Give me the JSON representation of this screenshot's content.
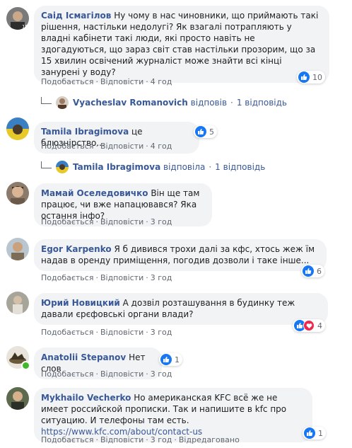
{
  "separator": "·",
  "comments": [
    {
      "author": "Саід Ісмагілов",
      "text": "Ну чому в нас чиновники, що приймають такі рішення, настільки недолугі? Як взагалі потрапляють у владні кабінети такі люди, які просто навіть не здогадуються, що зараз світ став настільки прозорим, що за 15 хвилин освічений журналіст може знайти всі кінці занурені у воду?",
      "like_label": "Подобається",
      "reply_label": "Відповісти",
      "time": "4 год",
      "reactions": 10,
      "reaction_types": [
        "like"
      ],
      "reply_summary": {
        "name": "Vyacheslav Romanovich",
        "verb": "відповів",
        "count_text": "1 відповідь"
      }
    },
    {
      "author": "Tamila Ibragimova",
      "text": "це блюзнірство...",
      "like_label": "Подобається",
      "reply_label": "Відповісти",
      "time": "4 год",
      "reactions": 5,
      "reaction_types": [
        "like"
      ],
      "reply_summary": {
        "name": "Tamila Ibragimova",
        "verb": "відповіла",
        "count_text": "1 відповідь"
      }
    },
    {
      "author": "Мамай Оселедовичко",
      "text": "Він ще там працює, чи вже напацювався? Яка остання інфо?",
      "like_label": "Подобається",
      "reply_label": "Відповісти",
      "time": "3 год"
    },
    {
      "author": "Egor Karpenko",
      "text": "Я б дивився трохи далі за кфс, хтось жеж їм надав в оренду приміщення, погодив дозволи і таке інше...",
      "like_label": "Подобається",
      "reply_label": "Відповісти",
      "time": "3 год",
      "reactions": 6,
      "reaction_types": [
        "like"
      ]
    },
    {
      "author": "Юрий Новицкий",
      "text": "А дозвіл розташування в будинку теж давали єрєфовські органи влади?",
      "like_label": "Подобається",
      "reply_label": "Відповісти",
      "time": "3 год",
      "reactions": 4,
      "reaction_types": [
        "like",
        "love"
      ]
    },
    {
      "author": "Anatolii Stepanov",
      "text": "Нет слов",
      "like_label": "Подобається",
      "reply_label": "Відповісти",
      "time": "3 год",
      "reactions": 1,
      "reaction_types": [
        "like"
      ],
      "online": true
    },
    {
      "author": "Mykhailo Vecherko",
      "text": "Но американская KFC всё же не имеет российской прописки. Так и напишите в kfc про ситуацию. И телефоны там есть.",
      "link": "https://www.kfc.com/about/contact-us",
      "like_label": "Подобається",
      "reply_label": "Відповісти",
      "time": "3 год",
      "edited_label": "Відредаговано",
      "reactions": 1,
      "reaction_types": [
        "like"
      ]
    }
  ],
  "icons": {
    "like": "thumbs-up-icon",
    "love": "heart-icon"
  },
  "colors": {
    "link": "#385898",
    "bubble": "#f2f3f5",
    "like": "#1877f2",
    "love": "#f0284a",
    "meta": "#606770"
  }
}
